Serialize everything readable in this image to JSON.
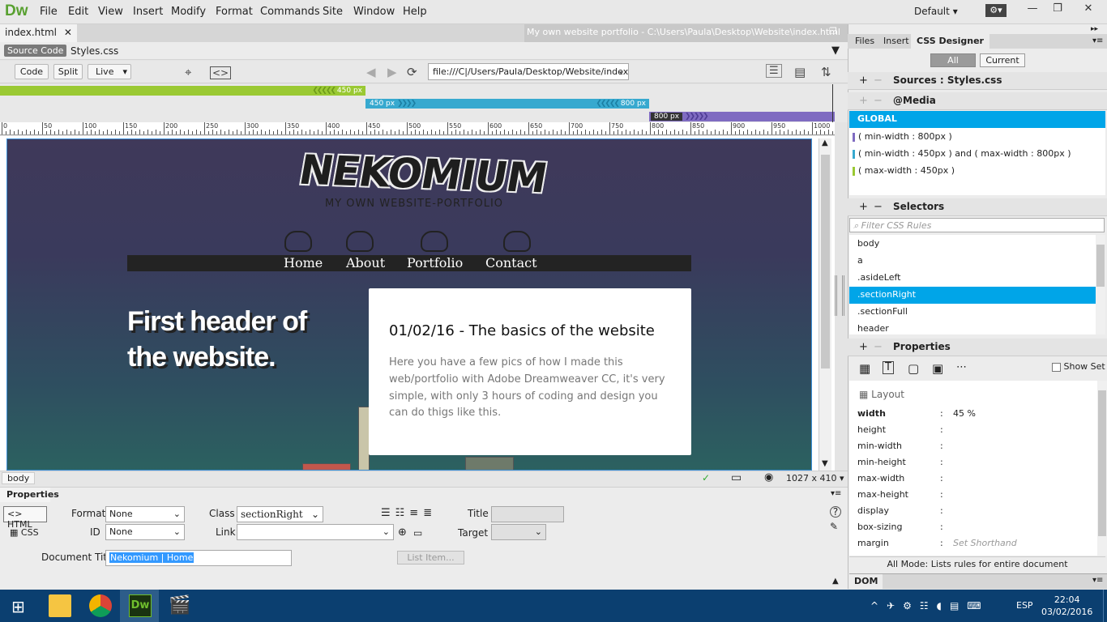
{
  "app": {
    "logo": "Dw",
    "workspace": "Default",
    "menus": [
      "File",
      "Edit",
      "View",
      "Insert",
      "Modify",
      "Format",
      "Commands",
      "Site",
      "Window",
      "Help"
    ]
  },
  "document": {
    "tab": "index.html",
    "path_title": "My own website portfolio - C:\\Users\\Paula\\Desktop\\Website\\index.html",
    "source_code": "Source Code",
    "related_file": "Styles.css"
  },
  "toolbar": {
    "code": "Code",
    "split": "Split",
    "live": "Live",
    "address": "file:///C|/Users/Paula/Desktop/Website/index.h"
  },
  "media_bars": {
    "mq_small": "450  px",
    "mq_mid_start": "450  px",
    "mq_mid_end": "800  px",
    "mq_large": "800  px"
  },
  "ruler": {
    "labels": [
      "0",
      "50",
      "100",
      "150",
      "200",
      "250",
      "300",
      "350",
      "400",
      "450",
      "500",
      "550",
      "600",
      "650",
      "700",
      "750",
      "800",
      "850",
      "900",
      "950",
      "1000"
    ]
  },
  "site": {
    "brand": "NEKOMIUM",
    "tagline": "MY OWN WEBSITE-PORTFOLIO",
    "nav": [
      "Home",
      "About",
      "Portfolio",
      "Contact"
    ],
    "hero": "First header of the website.",
    "card_title": "01/02/16 - The basics of the website",
    "card_text": "Here you have a few pics of how I made this web/portfolio with Adobe Dreamweaver CC, it's very simple, with only 3 hours of coding and design you can do thigs like this."
  },
  "status": {
    "tag": "body",
    "viewport": "1027 x 410"
  },
  "properties": {
    "title": "Properties",
    "html_btn": "HTML",
    "css_btn": "CSS",
    "format_label": "Format",
    "format_value": "None",
    "id_label": "ID",
    "id_value": "None",
    "class_label": "Class",
    "class_value": "sectionRight",
    "link_label": "Link",
    "title_label": "Title",
    "target_label": "Target",
    "doc_title_label": "Document Title",
    "doc_title_value": "Nekomium | Home",
    "list_item": "List Item..."
  },
  "panel": {
    "tabs": [
      "Files",
      "Insert",
      "CSS Designer"
    ],
    "all": "All",
    "current": "Current",
    "sources_label": "Sources :",
    "sources_value": "Styles.css",
    "media_label": "@Media",
    "global": "GLOBAL",
    "media_queries": [
      "( min-width : 800px )",
      "( min-width : 450px ) and ( max-width : 800px )",
      "( max-width : 450px )"
    ],
    "selectors_label": "Selectors",
    "filter_placeholder": "Filter CSS Rules",
    "selectors": [
      "body",
      "a",
      ".asideLeft",
      ".sectionRight",
      ".sectionFull",
      "header"
    ],
    "selected_selector": ".sectionRight",
    "properties_label": "Properties",
    "show_set": "Show Set",
    "layout_label": "Layout",
    "props": [
      {
        "name": "width",
        "value": "45  %"
      },
      {
        "name": "height",
        "value": ""
      },
      {
        "name": "min-width",
        "value": ""
      },
      {
        "name": "min-height",
        "value": ""
      },
      {
        "name": "max-width",
        "value": ""
      },
      {
        "name": "max-height",
        "value": ""
      },
      {
        "name": "display",
        "value": ""
      },
      {
        "name": "box-sizing",
        "value": ""
      },
      {
        "name": "margin",
        "value": "Set Shorthand"
      }
    ],
    "footer": "All Mode: Lists rules for entire document",
    "dom": "DOM"
  },
  "taskbar": {
    "lang": "ESP",
    "time": "22:04",
    "date": "03/02/2016"
  },
  "colors": {
    "mq_small": "#9ac933",
    "mq_mid": "#37a9cf",
    "mq_large": "#7f6bc1",
    "selection": "#00a5e8",
    "taskbar": "#0b3f70"
  }
}
